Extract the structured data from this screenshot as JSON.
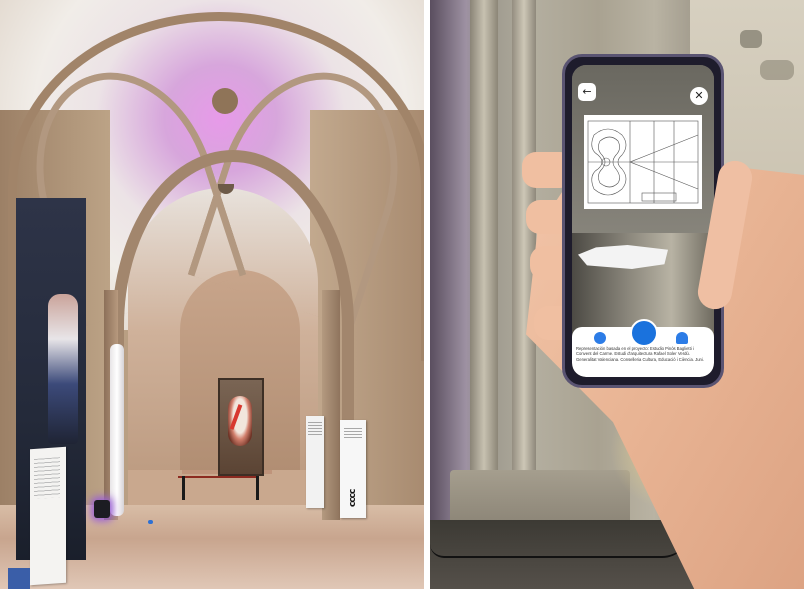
{
  "left_photo": {
    "sign_logo": "cccc"
  },
  "right_photo": {
    "phone_app": {
      "back_icon": "arrow-left-icon",
      "close_icon": "close-icon",
      "tabs": [
        {
          "icon": "globe-icon"
        },
        {
          "icon": "model-icon",
          "active": true
        },
        {
          "icon": "person-icon"
        }
      ],
      "credit_text": "Representación basada en el proyecto: Estudio Pinós Baglietti i Convent del Carme. Estudi d'arquitectura Rafael Soler Verdú. Generalitat Valenciana. Conselleria Cultura, Educació i Ciència. Juni.",
      "accent_color": "#1a72dd"
    }
  }
}
